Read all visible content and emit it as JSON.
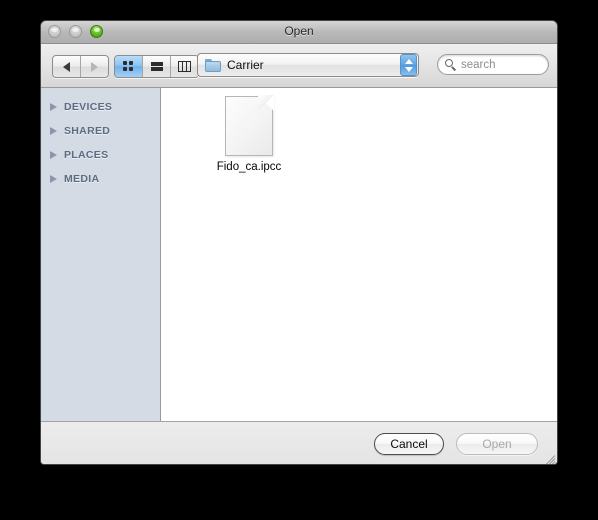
{
  "window": {
    "title": "Open"
  },
  "traffic_lights": [
    {
      "name": "close-button",
      "state": "disabled"
    },
    {
      "name": "minimize-button",
      "state": "disabled"
    },
    {
      "name": "zoom-button",
      "state": "enabled"
    }
  ],
  "toolbar": {
    "nav": {
      "back_icon": "triangle-left-icon",
      "forward_icon": "triangle-right-icon"
    },
    "view_modes": [
      {
        "id": "icon-view",
        "icon": "grid-icon",
        "selected": true
      },
      {
        "id": "list-view",
        "icon": "list-icon",
        "selected": false
      },
      {
        "id": "column-view",
        "icon": "columns-icon",
        "selected": false
      }
    ],
    "path_popup": {
      "icon": "folder-icon",
      "label": "Carrier",
      "stepper_icon": "up-down-arrows-icon"
    },
    "search": {
      "icon": "search-icon",
      "placeholder": "search",
      "value": ""
    }
  },
  "sidebar": {
    "items": [
      {
        "label": "DEVICES",
        "expanded": false
      },
      {
        "label": "SHARED",
        "expanded": false
      },
      {
        "label": "PLACES",
        "expanded": false
      },
      {
        "label": "MEDIA",
        "expanded": false
      }
    ]
  },
  "file_browser": {
    "files": [
      {
        "name": "Fido_ca.ipcc",
        "icon": "generic-document-icon",
        "selected": false
      }
    ]
  },
  "footer": {
    "cancel_label": "Cancel",
    "open_label": "Open",
    "open_enabled": false,
    "resize_grip_icon": "resize-grip-icon"
  },
  "colors": {
    "sidebar_background": "#d4dbe5",
    "sidebar_text": "#5d6c83",
    "selection_blue": "#6fb2ec",
    "window_background": "#e9e9e9",
    "desktop_background": "#000000"
  }
}
